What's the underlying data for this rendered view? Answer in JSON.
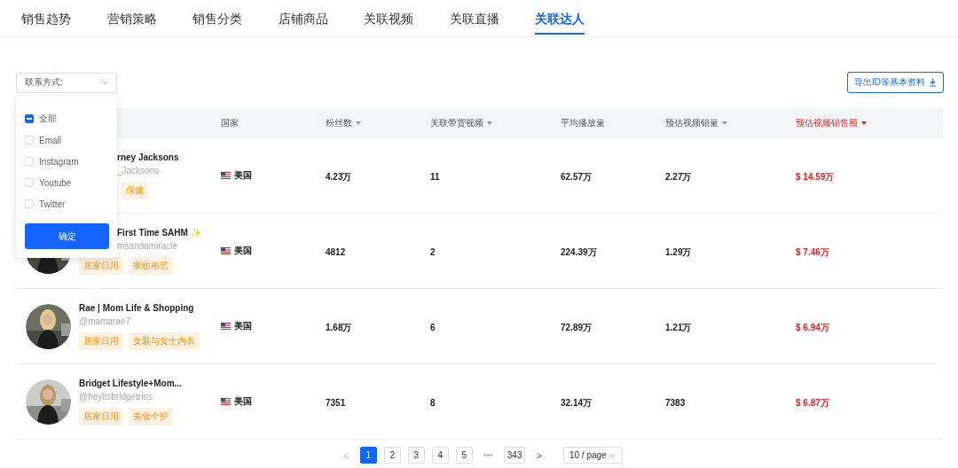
{
  "tabs": [
    {
      "label": "销售趋势",
      "selected": false
    },
    {
      "label": "营销策略",
      "selected": false
    },
    {
      "label": "销售分类",
      "selected": false
    },
    {
      "label": "店铺商品",
      "selected": false
    },
    {
      "label": "关联视频",
      "selected": false
    },
    {
      "label": "关联直播",
      "selected": false
    },
    {
      "label": "关联达人",
      "selected": true
    }
  ],
  "filter": {
    "label": "联系方式:",
    "expanded": true,
    "options": [
      {
        "label": "全部",
        "checked": false,
        "indeterminate": true
      },
      {
        "label": "Email",
        "checked": false,
        "indeterminate": false
      },
      {
        "label": "Instagram",
        "checked": false,
        "indeterminate": false
      },
      {
        "label": "Youtube",
        "checked": false,
        "indeterminate": false
      },
      {
        "label": "Twitter",
        "checked": false,
        "indeterminate": false
      }
    ],
    "confirm": "确定"
  },
  "export_button": "导出ID等基本资料",
  "table": {
    "columns": [
      {
        "label": "国家",
        "sortable": false,
        "sort_active": false
      },
      {
        "label": "粉丝数",
        "sortable": true,
        "sort_active": false
      },
      {
        "label": "关联带货视频",
        "sortable": true,
        "sort_active": false
      },
      {
        "label": "平均播放量",
        "sortable": false,
        "sort_active": false
      },
      {
        "label": "预估视频销量",
        "sortable": true,
        "sort_active": false
      },
      {
        "label": "预估视频销售额",
        "sortable": true,
        "sort_active": true
      }
    ],
    "rows": [
      {
        "name": "rney Jacksons",
        "handle": "_Jacksons",
        "covered": true,
        "tags": [
          "保健"
        ],
        "country": "美国",
        "fans": "4.23万",
        "videos": "11",
        "avg_views": "62.57万",
        "sales": "2.27万",
        "revenue": "$ 14.59万"
      },
      {
        "name": "First Time SAHM",
        "badge": "✨",
        "handle": "msandamiracle",
        "covered": true,
        "tags": [
          "居家日用",
          "家纺布艺"
        ],
        "country": "美国",
        "fans": "4812",
        "videos": "2",
        "avg_views": "224.39万",
        "sales": "1.29万",
        "revenue": "$ 7.46万"
      },
      {
        "name": "Rae | Mom Life & Shopping",
        "handle": "@mamarae7",
        "tags": [
          "居家日用",
          "女装与女士内衣"
        ],
        "country": "美国",
        "fans": "1.68万",
        "videos": "6",
        "avg_views": "72.89万",
        "sales": "1.21万",
        "revenue": "$ 6.94万"
      },
      {
        "name": "Bridget Lifestyle+Mom...",
        "handle": "@heyitsbridgetrios",
        "tags": [
          "居家日用",
          "美妆个护"
        ],
        "country": "美国",
        "fans": "7351",
        "videos": "8",
        "avg_views": "32.14万",
        "sales": "7383",
        "revenue": "$ 6.87万"
      }
    ]
  },
  "pagination": {
    "prev": "<",
    "pages": [
      {
        "label": "1",
        "selected": true
      },
      {
        "label": "2",
        "selected": false
      },
      {
        "label": "3",
        "selected": false
      },
      {
        "label": "4",
        "selected": false
      },
      {
        "label": "5",
        "selected": false
      },
      {
        "label": "•••",
        "kind": "ellipsis",
        "selected": false
      },
      {
        "label": "343",
        "selected": false
      }
    ],
    "next": ">",
    "page_size": "10 / page"
  }
}
